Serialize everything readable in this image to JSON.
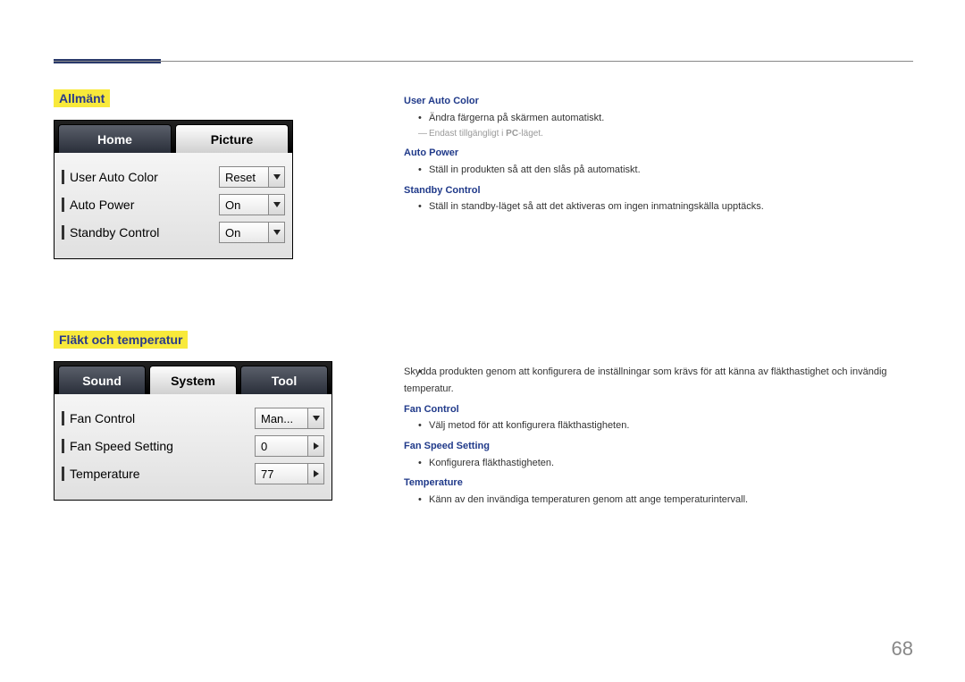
{
  "page": {
    "number": "68"
  },
  "section1": {
    "title": "Allmänt",
    "tabs": {
      "home": "Home",
      "picture": "Picture"
    },
    "rows": {
      "userAutoColor": {
        "label": "User Auto Color",
        "value": "Reset"
      },
      "autoPower": {
        "label": "Auto Power",
        "value": "On"
      },
      "standbyControl": {
        "label": "Standby Control",
        "value": "On"
      }
    }
  },
  "section2": {
    "title": "Fläkt och temperatur",
    "tabs": {
      "sound": "Sound",
      "system": "System",
      "tool": "Tool"
    },
    "rows": {
      "fanControl": {
        "label": "Fan Control",
        "value": "Man..."
      },
      "fanSpeed": {
        "label": "Fan Speed Setting",
        "value": "0"
      },
      "temperature": {
        "label": "Temperature",
        "value": "77"
      }
    }
  },
  "right": {
    "userAutoColor": {
      "head": "User Auto Color",
      "b1": "Ändra färgerna på skärmen automatiskt.",
      "notePrefix": "Endast tillgängligt i ",
      "noteBold": "PC",
      "noteSuffix": "-läget."
    },
    "autoPower": {
      "head": "Auto Power",
      "b1": "Ställ in produkten så att den slås på automatiskt."
    },
    "standbyControl": {
      "head": "Standby Control",
      "b1": "Ställ in standby-läget så att det aktiveras om ingen inmatningskälla upptäcks."
    },
    "fanIntro": "Skydda produkten genom att konfigurera de inställningar som krävs för att känna av fläkthastighet och invändig temperatur.",
    "fanControl": {
      "head": "Fan Control",
      "b1": "Välj metod för att konfigurera fläkthastigheten."
    },
    "fanSpeed": {
      "head": "Fan Speed Setting",
      "b1": "Konfigurera fläkthastigheten."
    },
    "temperature": {
      "head": "Temperature",
      "b1": "Känn av den invändiga temperaturen genom att ange temperaturintervall."
    }
  }
}
